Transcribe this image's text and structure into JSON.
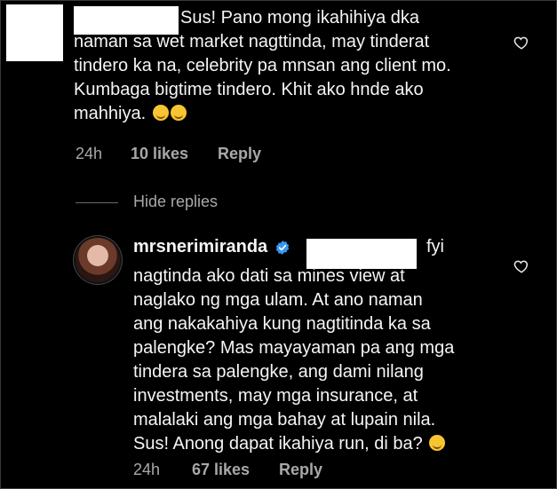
{
  "comment": {
    "text_lines": [
      "Sus! Pano mong ikahihiya dka",
      "naman sa wet market nagttinda, may tinderat",
      "tindero ka na, celebrity pa mnsan ang client mo.",
      "Kumbaga bigtime tindero. Khit ako hnde ako",
      "mahhiya."
    ],
    "emoji": "😅😅",
    "time": "24h",
    "likes": "10 likes",
    "reply_label": "Reply"
  },
  "thread": {
    "hide_replies_label": "Hide replies"
  },
  "reply": {
    "username": "mrsnerimiranda",
    "first_line_tail": "fyi",
    "text_lines": [
      "nagtinda ako dati sa mines view at",
      "naglako ng mga ulam. At ano naman",
      "ang nakakahiya kung nagtitinda ka sa",
      "palengke? Mas mayayaman pa ang mga",
      "tindera sa palengke, ang dami nilang",
      "investments, may mga insurance, at",
      "malalaki ang mga bahay at lupain nila.",
      "Sus! Anong dapat ikahiya run, di ba?"
    ],
    "emoji": "😊",
    "time": "24h",
    "likes": "67 likes",
    "reply_label": "Reply"
  },
  "icons": {
    "heart": "heart-outline-icon",
    "verified": "verified-badge-icon"
  },
  "colors": {
    "background": "#000000",
    "text": "#f5f5f5",
    "secondary_text": "#a8a8a8",
    "verified_blue": "#3897f0"
  }
}
